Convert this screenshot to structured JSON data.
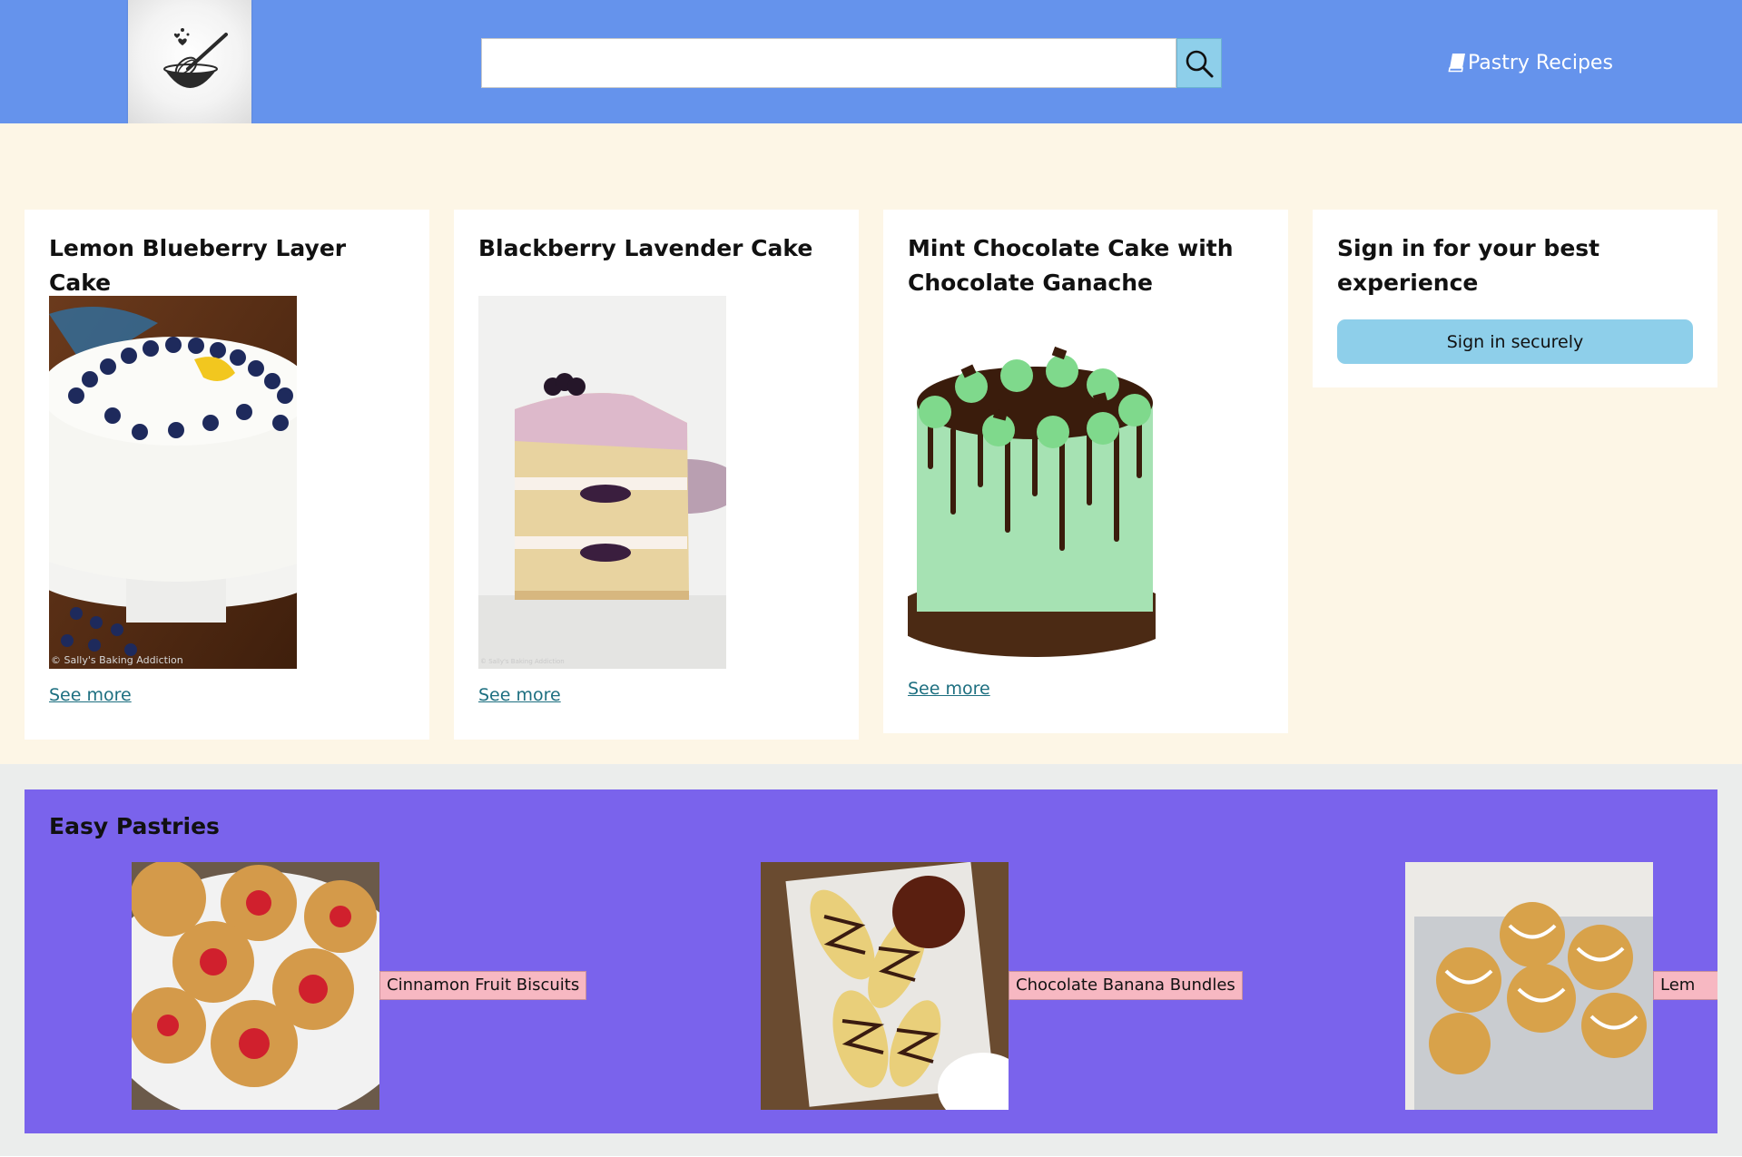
{
  "header": {
    "logo_alt": "whisk and bowl logo",
    "search": {
      "value": "",
      "placeholder": ""
    },
    "nav_link": "Pastry Recipes",
    "colors": {
      "bar": "#6593ec",
      "search_button": "#8ecfea"
    }
  },
  "featured": {
    "cards": [
      {
        "title": "Lemon Blueberry Layer Cake",
        "image": "lemon-blueberry-cake-photo",
        "watermark": "© Sally's Baking Addiction",
        "link": "See more"
      },
      {
        "title": "Blackberry Lavender Cake",
        "image": "blackberry-lavender-cake-photo",
        "watermark": "© Sally's Baking Addiction",
        "link": "See more"
      },
      {
        "title": "Mint Chocolate Cake with Chocolate Ganache",
        "image": "mint-chocolate-cake-photo",
        "link": "See more"
      }
    ],
    "signin": {
      "title": "Sign in for your best experience",
      "button": "Sign in securely"
    }
  },
  "easy_pastries": {
    "title": "Easy Pastries",
    "items": [
      {
        "label": "Cinnamon Fruit Biscuits",
        "image": "fruit-biscuits-photo"
      },
      {
        "label": "Chocolate Banana Bundles",
        "image": "banana-bundles-photo"
      },
      {
        "label": "Lem",
        "image": "lemon-muffins-photo"
      }
    ],
    "colors": {
      "background": "#7a63ec",
      "label": "#f7b8c2"
    }
  }
}
